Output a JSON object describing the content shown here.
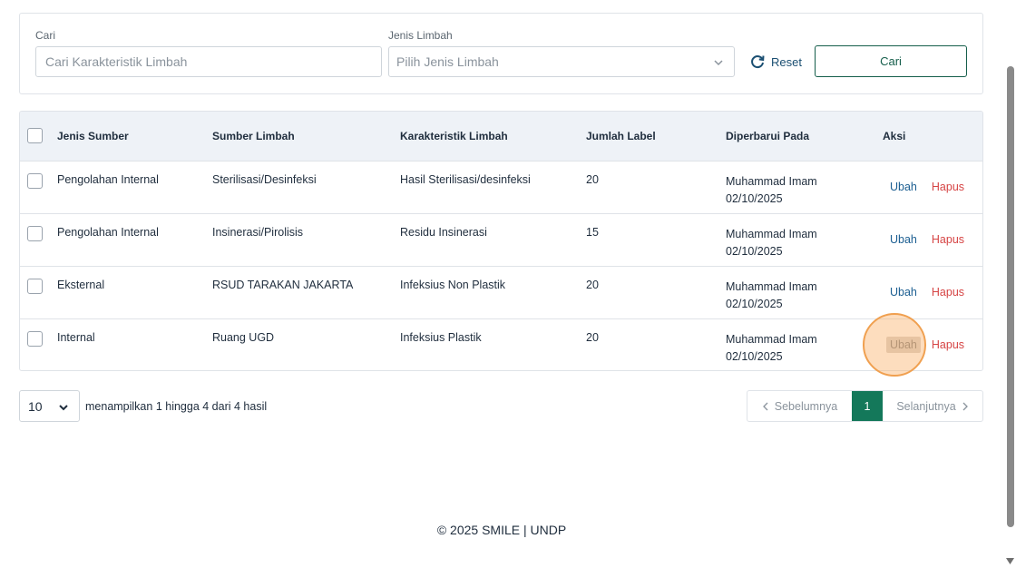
{
  "filters": {
    "search_label": "Cari",
    "search_placeholder": "Cari Karakteristik Limbah",
    "type_label": "Jenis Limbah",
    "type_placeholder": "Pilih Jenis Limbah",
    "reset_label": "Reset",
    "search_button": "Cari"
  },
  "table": {
    "headers": [
      "Jenis Sumber",
      "Sumber Limbah",
      "Karakteristik Limbah",
      "Jumlah Label",
      "Diperbarui Pada",
      "Aksi"
    ],
    "rows": [
      {
        "jenis_sumber": "Pengolahan Internal",
        "sumber_limbah": "Sterilisasi/Desinfeksi",
        "karakteristik": "Hasil Sterilisasi/desinfeksi",
        "jumlah": "20",
        "updated_by": "Muhammad Imam",
        "updated_on": "02/10/2025"
      },
      {
        "jenis_sumber": "Pengolahan Internal",
        "sumber_limbah": "Insinerasi/Pirolisis",
        "karakteristik": "Residu Insinerasi",
        "jumlah": "15",
        "updated_by": "Muhammad Imam",
        "updated_on": "02/10/2025"
      },
      {
        "jenis_sumber": "Eksternal",
        "sumber_limbah": "RSUD TARAKAN JAKARTA",
        "karakteristik": "Infeksius Non Plastik",
        "jumlah": "20",
        "updated_by": "Muhammad Imam",
        "updated_on": "02/10/2025"
      },
      {
        "jenis_sumber": "Internal",
        "sumber_limbah": "Ruang UGD",
        "karakteristik": "Infeksius Plastik",
        "jumlah": "20",
        "updated_by": "Muhammad Imam",
        "updated_on": "02/10/2025"
      }
    ],
    "edit_label": "Ubah",
    "delete_label": "Hapus"
  },
  "pagination": {
    "page_size": "10",
    "info": "menampilkan 1 hingga 4 dari 4 hasil",
    "prev_label": "Sebelumnya",
    "current_page": "1",
    "next_label": "Selanjutnya"
  },
  "footer": {
    "text": "© 2025 SMILE | UNDP"
  },
  "colors": {
    "primary": "#14785a",
    "link": "#1b5e91",
    "danger": "#d64545",
    "header_bg": "#eef2f7"
  }
}
